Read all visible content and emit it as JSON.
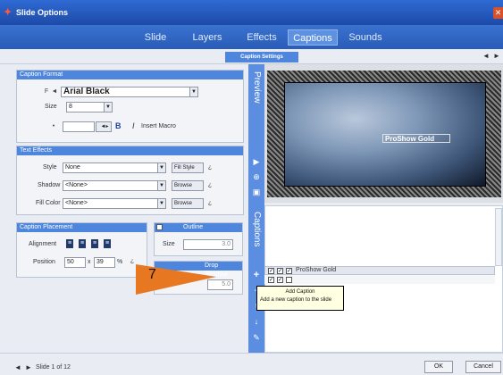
{
  "window": {
    "title": "Slide Options"
  },
  "tabs": [
    {
      "label": "Slide"
    },
    {
      "label": "Layers"
    },
    {
      "label": "Effects"
    },
    {
      "label": "Captions"
    },
    {
      "label": "Sounds"
    }
  ],
  "subtab": {
    "label": "Caption Settings"
  },
  "nav": {
    "prev": "◄",
    "next": "►"
  },
  "caption_format": {
    "header": "Caption Format",
    "font_value": "Arial Black",
    "size_label": "Size",
    "size_value": "8",
    "color_label": "",
    "bold": "B",
    "italic": "I",
    "macro_label": "Insert Macro"
  },
  "text_effects": {
    "header": "Text Effects",
    "rows": [
      {
        "label": "Style",
        "value": "None",
        "button": "Fill Style"
      },
      {
        "label": "Shadow",
        "value": "<None>",
        "button": "Browse"
      },
      {
        "label": "Fill Color",
        "value": "<None>",
        "button": "Browse"
      }
    ]
  },
  "caption_placement": {
    "header": "Caption Placement",
    "alignment_label": "Alignment",
    "position_label": "Position",
    "x_value": "50",
    "y_value": "39",
    "percent": "%"
  },
  "outline": {
    "header": "Outline",
    "size_label": "Size",
    "size_value": "3.0"
  },
  "drop_shadow": {
    "header": "Drop Shadow",
    "value": "5.0"
  },
  "preview": {
    "label": "Preview",
    "caption_text": "ProShow Gold"
  },
  "captions_panel": {
    "label": "Captions",
    "row1": "ProShow Gold",
    "tooltip_title": "Add Caption",
    "tooltip_text": "Add a new caption to the slide"
  },
  "callout": {
    "number": "7",
    "color": "#e87722"
  },
  "footer": {
    "slide_info": "Slide 1 of 12",
    "ok": "OK",
    "cancel": "Cancel"
  },
  "colors": {
    "title_bar": "#2f6ad3",
    "accent": "#4d86dc",
    "callout": "#e87722"
  }
}
